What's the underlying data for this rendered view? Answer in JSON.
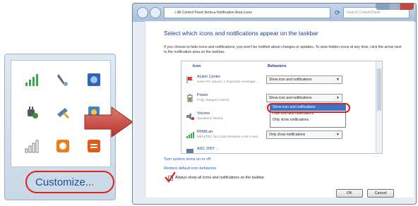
{
  "tray": {
    "icons": [
      {
        "icon": "wifi-signal-icon",
        "color": "#3aa84a"
      },
      {
        "icon": "pen-tablet-icon",
        "color": "#5a6d7e"
      },
      {
        "icon": "network-app-icon",
        "color": "#2d64b5"
      },
      {
        "icon": "power-plug-icon",
        "color": "#4a8a3a"
      },
      {
        "icon": "remove-device-icon",
        "color": "#e0a020"
      },
      {
        "icon": "paint-app-icon",
        "color": "#3a86c9"
      },
      {
        "icon": "signal-bars-icon",
        "color": "#7d7d7d"
      },
      {
        "icon": "messenger-icon",
        "color": "#ea7d1e"
      },
      {
        "icon": "app-shield-icon",
        "color": "#e05a1a"
      }
    ],
    "customize_label": "Customize..."
  },
  "window": {
    "address": "« All Control Panel Items ▸ Notification Area Icons",
    "search_placeholder": "Search Control Panel",
    "heading": "Select which icons and notifications appear on the taskbar",
    "description": "If you choose to hide icons and notifications, you won't be notified about changes or updates. To view hidden icons at any time, click the arrow next to the notification area on the taskbar.",
    "columns": {
      "icon": "Icon",
      "behaviors": "Behaviors"
    },
    "rows": [
      {
        "name": "Action Center",
        "sub": "Solve PC issues: 1 important message ...",
        "behavior": "Show icon and notifications",
        "icon": "action-center-flag-icon"
      },
      {
        "name": "Power",
        "sub": "Fully charged (100%)",
        "behavior": "Show icon and notifications",
        "icon": "power-battery-icon"
      },
      {
        "name": "Volume",
        "sub": "Speakers: Muted",
        "behavior": "",
        "icon": "volume-speaker-icon"
      },
      {
        "name": "RNWLan",
        "sub": "REALTEK 11n USB Wireless LAN U-sen...",
        "behavior": "Only show notifications",
        "icon": "wireless-lan-icon"
      },
      {
        "name": "ASC 2007 ...",
        "sub": "",
        "behavior": "",
        "icon": "app-generic-icon"
      }
    ],
    "dropdown_options": [
      "Show icon and notifications",
      "Hide icon and notifications",
      "Only show notifications"
    ],
    "selected_option_index": 0,
    "links": {
      "system_icons": "Turn system icons on or off",
      "restore": "Restore default icon behaviors"
    },
    "always_show_label": "Always show all icons and notifications on the taskbar",
    "always_show_checked": true,
    "ok_label": "OK",
    "cancel_label": "Cancel"
  },
  "colors": {
    "highlight": "#d72020",
    "link": "#1e5fbf",
    "heading": "#1e3f8c",
    "selection": "#3a74c9"
  }
}
